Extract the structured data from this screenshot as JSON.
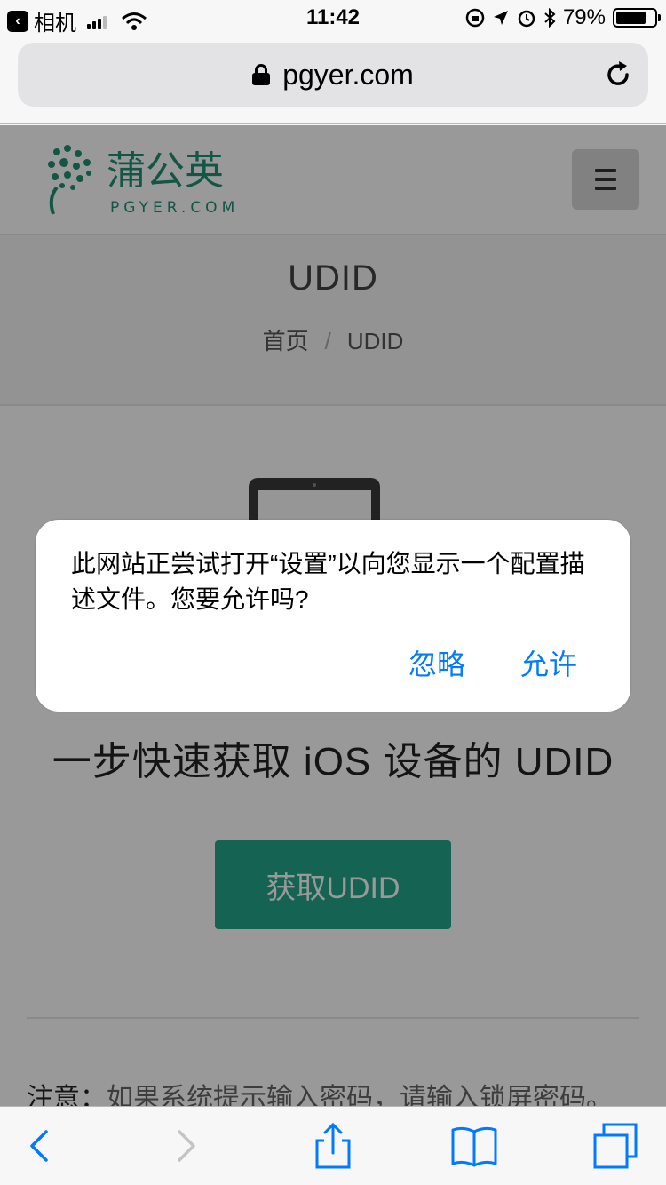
{
  "status_bar": {
    "back_app": "相机",
    "time": "11:42",
    "battery": "79%",
    "battery_level": 0.79
  },
  "browser": {
    "url": "pgyer.com"
  },
  "site": {
    "logo_text": "蒲公英",
    "logo_sub": "PGYER.COM",
    "page_title": "UDID",
    "breadcrumb": {
      "home": "首页",
      "separator": "/",
      "current": "UDID"
    },
    "headline": "一步快速获取 iOS 设备的 UDID",
    "get_udid_button": "获取UDID",
    "note_label": "注意：",
    "note_text": "如果系统提示输入密码，请输入锁屏密码。"
  },
  "alert": {
    "message": "此网站正尝试打开“设置”以向您显示一个配置描述文件。您要允许吗?",
    "ignore": "忽略",
    "allow": "允许"
  },
  "icons": {
    "back": "chevron-left-icon",
    "forward": "chevron-right-icon",
    "share": "share-icon",
    "bookmarks": "book-icon",
    "tabs": "tabs-icon",
    "reload": "reload-icon",
    "lock": "lock-icon",
    "menu": "hamburger-icon"
  },
  "colors": {
    "brand_green": "#22a58a",
    "ios_blue": "#007aff"
  }
}
